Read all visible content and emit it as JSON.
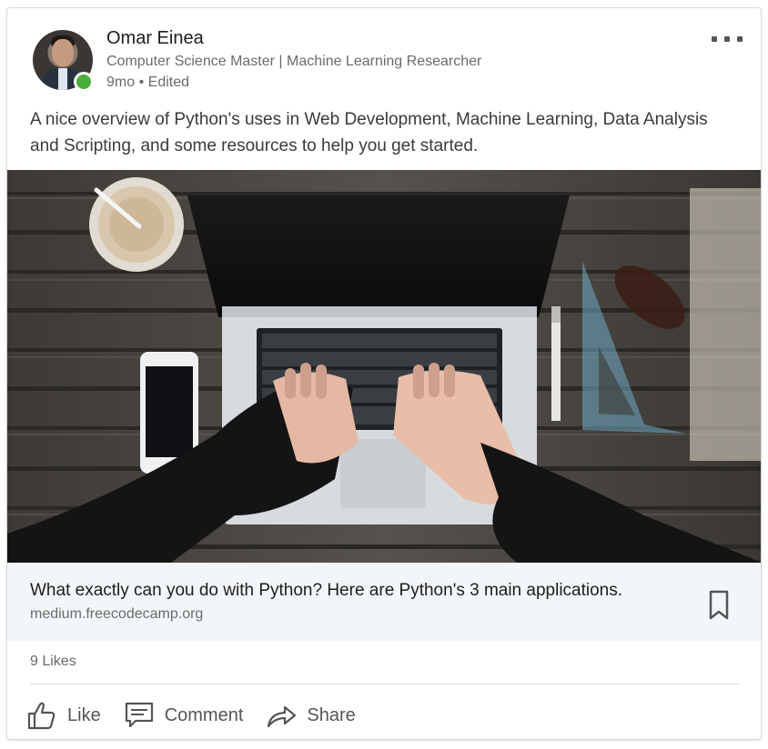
{
  "post": {
    "author_name": "Omar Einea",
    "author_headline": "Computer Science Master | Machine Learning Researcher",
    "time": "9mo",
    "separator": "•",
    "edited": "Edited",
    "text": "A nice overview of Python's uses in Web Development, Machine Learning, Data Analysis and Scripting, and some resources to help you get started."
  },
  "link": {
    "title": "What exactly can you do with Python? Here are Python's 3 main applications.",
    "source": "medium.freecodecamp.org"
  },
  "social": {
    "likes": "9 Likes"
  },
  "actions": {
    "like": "Like",
    "comment": "Comment",
    "share": "Share"
  },
  "icons": {
    "more": "more-icon",
    "bookmark": "bookmark-icon",
    "like": "thumbs-up-icon",
    "comment": "comment-icon",
    "share": "share-arrow-icon"
  },
  "colors": {
    "presence": "#4cae3a",
    "link_bg": "#f3f6f8",
    "text_secondary": "#6b6b6b"
  }
}
